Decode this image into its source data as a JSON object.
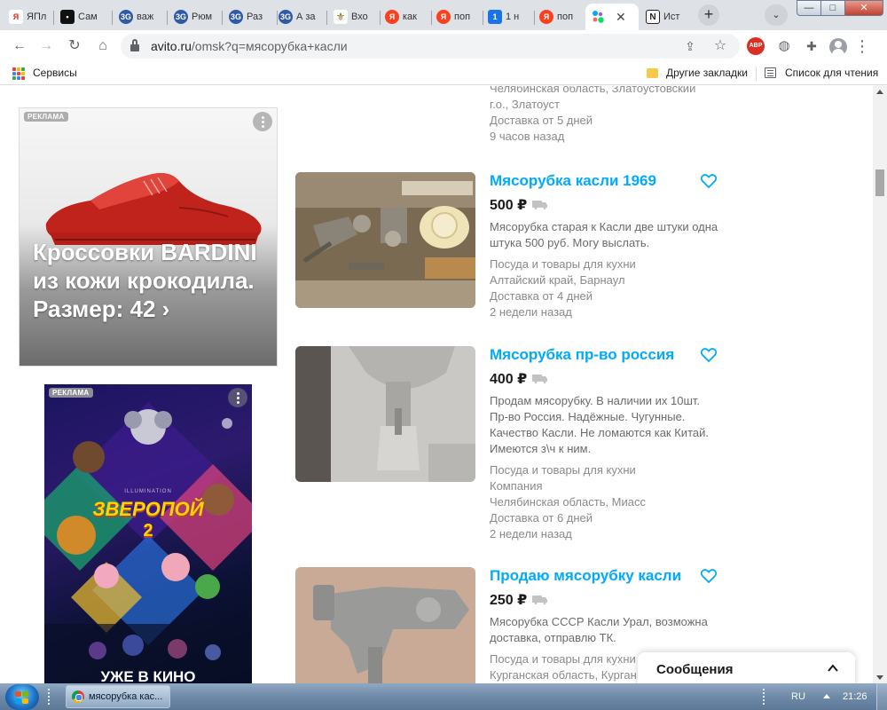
{
  "browser": {
    "tabs": [
      {
        "label": "ЯПл",
        "color": "#e52620",
        "text": "Я"
      },
      {
        "label": "Сам",
        "color": "#111111",
        "text": "▪"
      },
      {
        "label": "важ",
        "color": "#2f5aa8",
        "text": "3G"
      },
      {
        "label": "Рюм",
        "color": "#2f5aa8",
        "text": "3G"
      },
      {
        "label": "Раз",
        "color": "#2f5aa8",
        "text": "3G"
      },
      {
        "label": "А за",
        "color": "#2f5aa8",
        "text": "3G"
      },
      {
        "label": "Вхо",
        "color": "#d8b43a",
        "text": "⚜"
      },
      {
        "label": "как",
        "color": "#fc3f1d",
        "text": "Я"
      },
      {
        "label": "поп",
        "color": "#fc3f1d",
        "text": "Я"
      },
      {
        "label": "1 н",
        "color": "#1a73e8",
        "text": "1"
      },
      {
        "label": "поп",
        "color": "#fc3f1d",
        "text": "Я"
      },
      {
        "label": "",
        "color": "#ffffff",
        "text": ""
      },
      {
        "label": "Ист",
        "color": "#222222",
        "text": "N"
      }
    ],
    "active_tab_close": "✕",
    "new_tab": "+",
    "tab_search": "⌄",
    "window_controls": {
      "minimize": "—",
      "maximize": "□",
      "close": "✕"
    },
    "url_host": "avito.ru",
    "url_rest": "/omsk?q=мясорубка+касли",
    "abp_label": "ABP"
  },
  "bookmarks": {
    "apps_label": "Сервисы",
    "other_label": "Другие закладки",
    "reading_list_label": "Список для чтения"
  },
  "ads": {
    "badge": "РЕКЛАМА",
    "shoe_text": "Кроссовки BARDINI из кожи крокодила. Размер: 42 ›",
    "film_studio": "ILLUMINATION",
    "film_title": "ЗВЕРОПОЙ",
    "film_number": "2",
    "film_tagline": "УЖЕ В КИНО"
  },
  "top_listing_rest": {
    "line1": "Челябинская область, Златоустовский",
    "line2": "г.о., Златоуст",
    "delivery": "Доставка от 5 дней",
    "time": "9 часов назад"
  },
  "listings": [
    {
      "title": "Мясорубка касли 1969",
      "price": "500 ₽",
      "description": "Мясорубка старая к Касли две штуки одна штука 500 руб. Могу выслать.",
      "category": "Посуда и товары для кухни",
      "location": "Алтайский край, Барнаул",
      "extra": "",
      "delivery": "Доставка от 4 дней",
      "time": "2 недели назад"
    },
    {
      "title": "Мясорубка пр-во россия",
      "price": "400 ₽",
      "description": "Продам мясорубку. В наличии их 10шт. Пр-во Россия. Надёжные. Чугунные. Качество Касли. Не ломаются как Китай. Имеются з\\ч к ним.",
      "category": "Посуда и товары для кухни",
      "location": "Компания",
      "extra": "Челябинская область, Миасс",
      "delivery": "Доставка от 6 дней",
      "time": "2 недели назад"
    },
    {
      "title": "Продаю мясорубку касли",
      "price": "250 ₽",
      "description": "Мясорубка СССР Касли Урал, возможна доставка, отправлю ТК.",
      "category": "Посуда и товары для кухни",
      "location": "Курганская область, Курган",
      "extra": "",
      "delivery": "",
      "time": ""
    }
  ],
  "messages": {
    "label": "Сообщения"
  },
  "taskbar": {
    "task_label": "мясорубка кас...",
    "lang": "RU",
    "time": "21:26"
  },
  "colors": {
    "link": "#00aaff",
    "accent_tab_bg": "#dee1e6"
  }
}
